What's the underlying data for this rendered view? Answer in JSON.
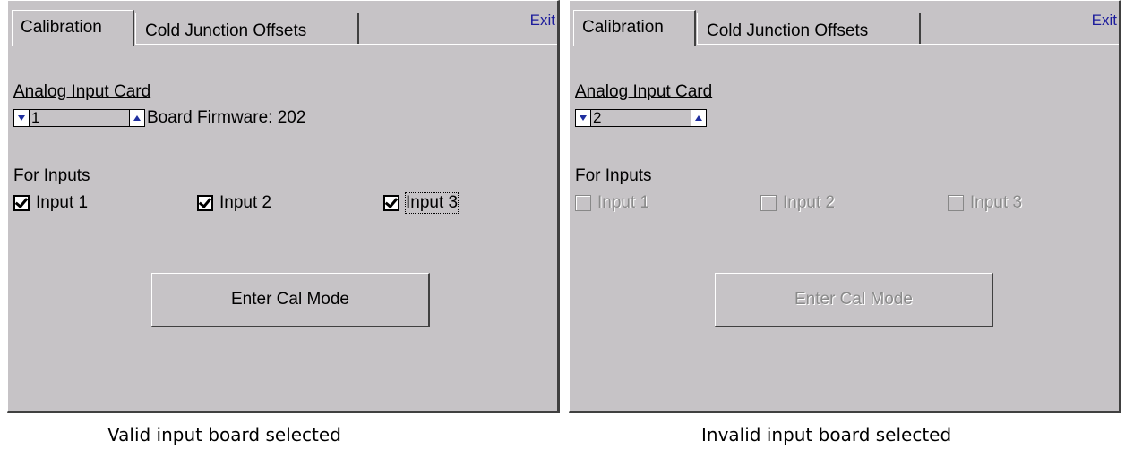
{
  "left_panel": {
    "tabs": [
      "Calibration",
      "Cold Junction Offsets"
    ],
    "exit_label": "Exit",
    "analog_input_card_label": "Analog Input Card",
    "card_value": "1",
    "board_firmware": "Board Firmware: 202",
    "for_inputs_label": "For Inputs",
    "inputs": [
      {
        "label": "Input 1",
        "checked": true,
        "enabled": true
      },
      {
        "label": "Input 2",
        "checked": true,
        "enabled": true
      },
      {
        "label": "Input 3",
        "checked": true,
        "enabled": true
      }
    ],
    "button_label": "Enter Cal Mode",
    "button_enabled": true,
    "caption": "Valid input board selected"
  },
  "right_panel": {
    "tabs": [
      "Calibration",
      "Cold Junction Offsets"
    ],
    "exit_label": "Exit",
    "analog_input_card_label": "Analog Input Card",
    "card_value": "2",
    "for_inputs_label": "For Inputs",
    "inputs": [
      {
        "label": "Input 1",
        "checked": false,
        "enabled": false
      },
      {
        "label": "Input 2",
        "checked": false,
        "enabled": false
      },
      {
        "label": "Input 3",
        "checked": false,
        "enabled": false
      }
    ],
    "button_label": "Enter Cal Mode",
    "button_enabled": false,
    "caption": "Invalid input board selected"
  },
  "colors": {
    "panel_bg": "#c6c3c6",
    "exit_link": "#1c1c9c",
    "spinner_arrow": "#1f2f9f",
    "disabled_text": "#8a8a8a"
  },
  "icons": [
    "chevron-down-icon",
    "chevron-up-icon",
    "checkmark-icon"
  ]
}
